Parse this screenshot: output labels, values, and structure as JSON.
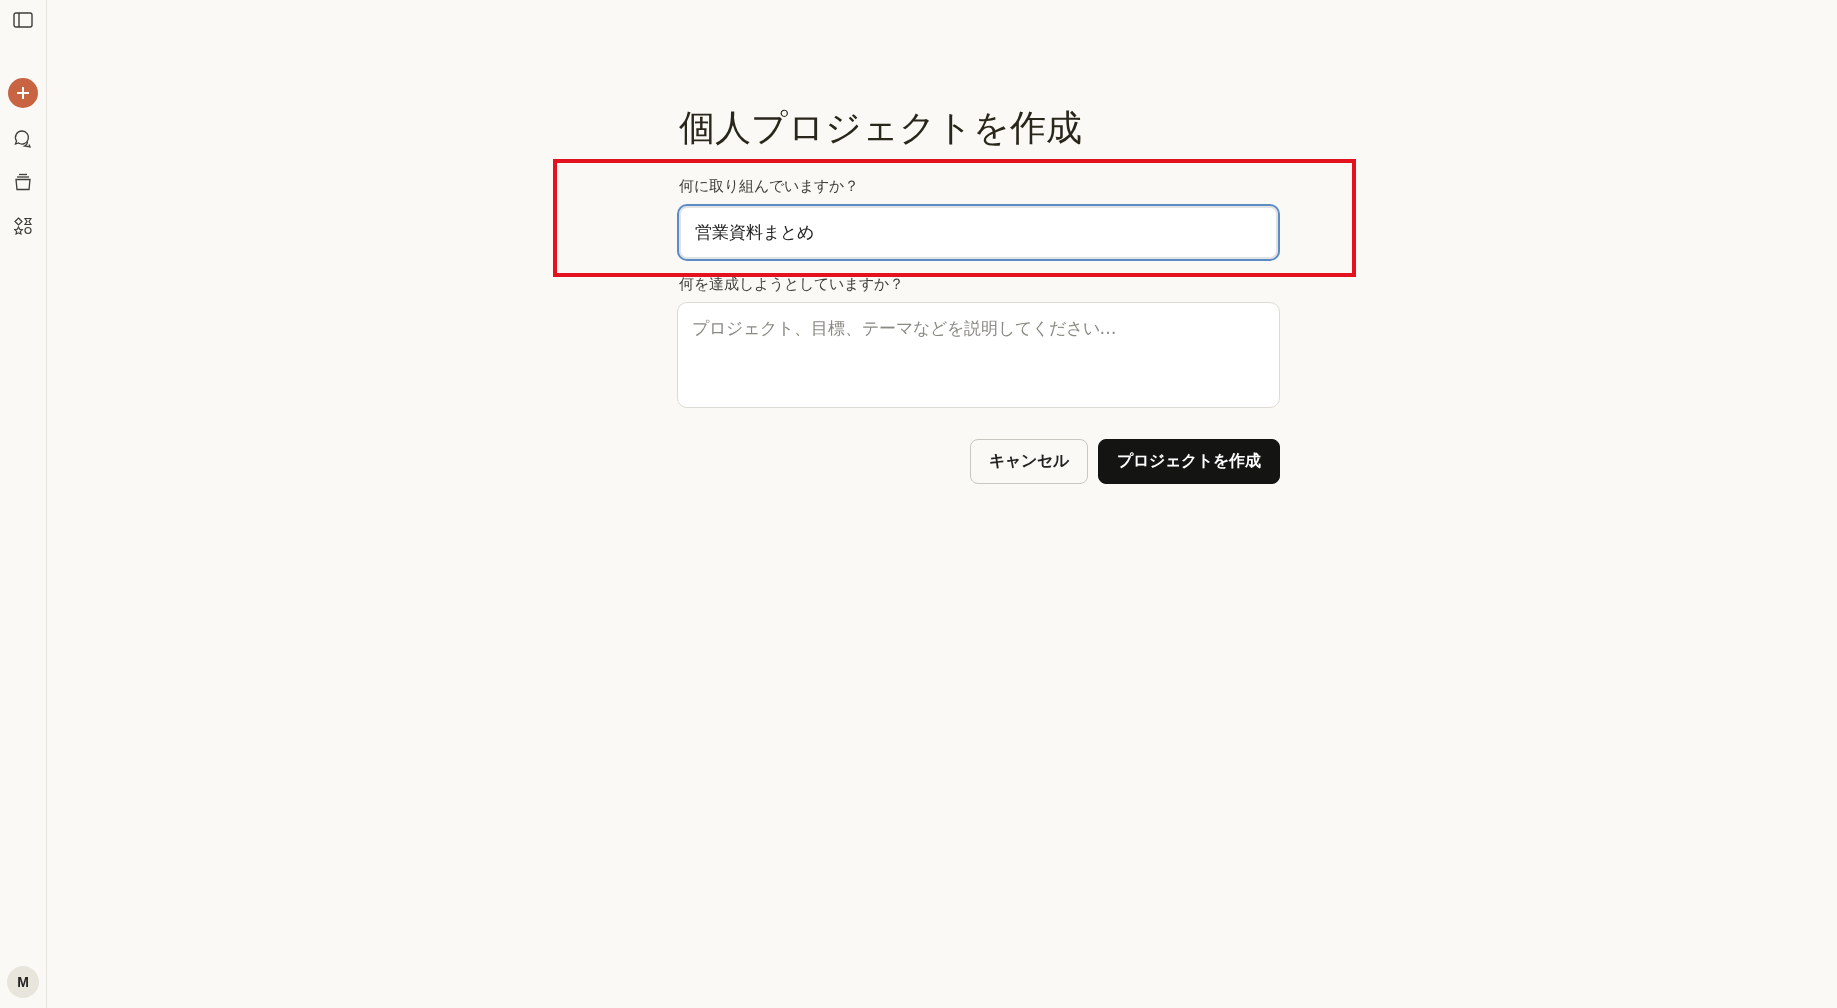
{
  "sidebar": {
    "items": [
      {
        "kind": "toggle"
      },
      {
        "kind": "new"
      },
      {
        "kind": "chats"
      },
      {
        "kind": "projects"
      },
      {
        "kind": "artifacts"
      }
    ],
    "avatar": "M"
  },
  "form": {
    "title": "個人プロジェクトを作成",
    "fields": [
      {
        "label": "何に取り組んでいますか？",
        "kind": "input",
        "value": "営業資料まとめ",
        "focused": true,
        "highlighted": true
      },
      {
        "label": "何を達成しようとしていますか？",
        "kind": "textarea",
        "placeholder": "プロジェクト、目標、テーマなどを説明してください…",
        "focused": false,
        "highlighted": false
      }
    ],
    "buttons": [
      {
        "label": "キャンセル",
        "kind": "secondary"
      },
      {
        "label": "プロジェクトを作成",
        "kind": "primary"
      }
    ]
  }
}
